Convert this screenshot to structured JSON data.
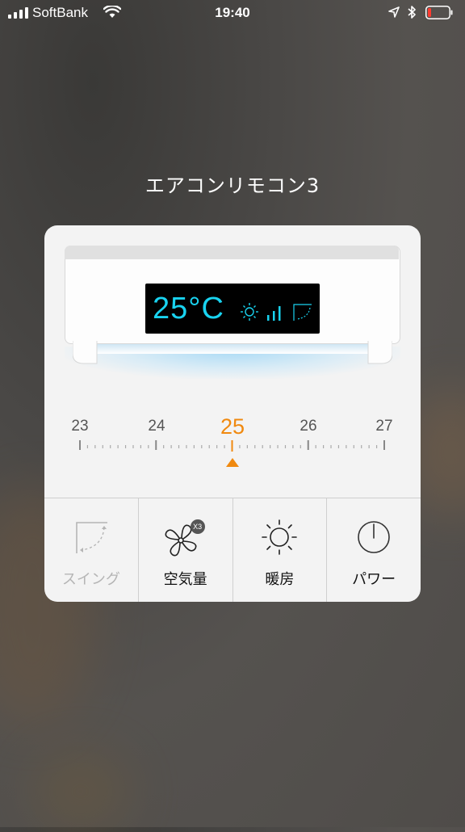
{
  "status_bar": {
    "carrier": "SoftBank",
    "time": "19:40",
    "battery_level": 0.1
  },
  "title": "エアコンリモコン3",
  "display": {
    "temperature": "25°C",
    "mode_icon": "sun-icon",
    "fan_icon": "fan-level-icon",
    "swing_icon": "swing-icon",
    "color": "#19d3f0"
  },
  "temperature_scale": {
    "labels": [
      "23",
      "24",
      "25",
      "26",
      "27"
    ],
    "selected": "25",
    "accent_color": "#f0890f"
  },
  "buttons": [
    {
      "label": "スイング",
      "icon": "swing-icon",
      "enabled": false
    },
    {
      "label": "空気量",
      "icon": "fan-icon",
      "badge": "X3",
      "enabled": true
    },
    {
      "label": "暖房",
      "icon": "sun-icon",
      "enabled": true
    },
    {
      "label": "パワー",
      "icon": "power-icon",
      "enabled": true
    }
  ]
}
